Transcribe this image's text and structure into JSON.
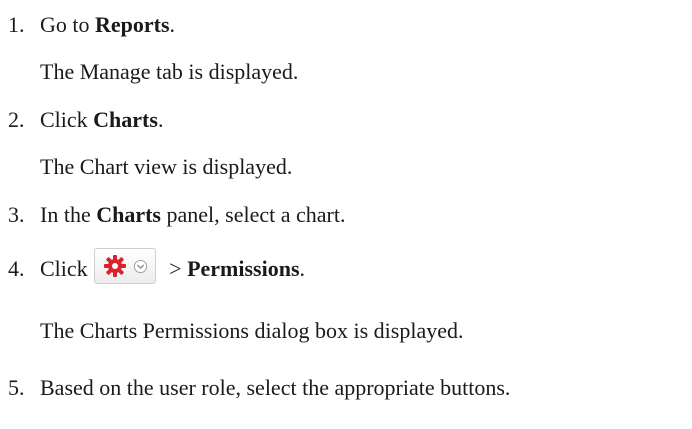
{
  "steps": [
    {
      "number": "1.",
      "prefix": "Go to ",
      "bold": "Reports",
      "suffix": ".",
      "result": "The Manage tab is displayed."
    },
    {
      "number": "2.",
      "prefix": "Click ",
      "bold": "Charts",
      "suffix": ".",
      "result": "The Chart view is displayed."
    },
    {
      "number": "3.",
      "prefix": "In the ",
      "bold": "Charts",
      "suffix": " panel, select a chart."
    },
    {
      "number": "4.",
      "prefix": "Click",
      "separator": " > ",
      "bold": "Permissions",
      "suffix": ".",
      "result": "The Charts Permissions dialog box is displayed."
    },
    {
      "number": "5.",
      "text": "Based on the user role, select the appropriate buttons."
    }
  ],
  "toolbar_button": {
    "icons": [
      "gear-icon",
      "chevron-down-icon"
    ],
    "gear_color": "#d9232d"
  }
}
